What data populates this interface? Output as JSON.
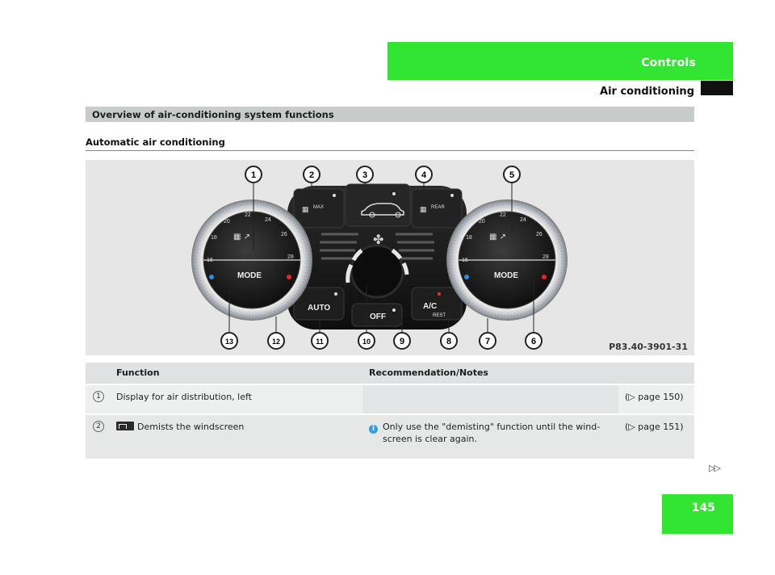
{
  "header": {
    "section": "Controls",
    "subtitle": "Air conditioning"
  },
  "section_title": "Overview of air-conditioning system functions",
  "heading": "Automatic air conditioning",
  "figure": {
    "code": "P83.40-3901-31",
    "callouts": [
      "1",
      "2",
      "3",
      "4",
      "5",
      "6",
      "7",
      "8",
      "9",
      "10",
      "11",
      "12",
      "13"
    ],
    "buttons": {
      "mode_left": "MODE",
      "mode_right": "MODE",
      "auto": "AUTO",
      "off": "OFF",
      "ac": "A/C",
      "rest": "REST",
      "max": "MAX",
      "rear": "REAR"
    },
    "temp_scale": [
      "16",
      "18",
      "20",
      "22",
      "24",
      "26",
      "28"
    ]
  },
  "table": {
    "headers": [
      "",
      "Function",
      "Recommendation/Notes",
      ""
    ],
    "rows": [
      {
        "num": "1",
        "function": "Display for air distribution, left",
        "notes": "",
        "page": "(▷ page 150)"
      },
      {
        "num": "2",
        "function": "Demists the windscreen",
        "notes_line1": "Only use the \"demisting\" function until the wind-",
        "notes_line2": "screen is clear again.",
        "page": "(▷ page 151)"
      }
    ]
  },
  "continue_marker": "▷▷",
  "page_number": "145",
  "colors": {
    "accent_green": "#33e533",
    "section_bar": "#c8cbcc",
    "info_blue": "#2fa0e0"
  }
}
